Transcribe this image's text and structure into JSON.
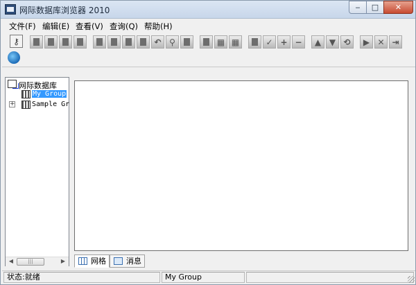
{
  "window": {
    "title": "网际数据库浏览器 2010",
    "controls": {
      "minimize": "‒",
      "maximize": "□",
      "close": "✕"
    }
  },
  "menu": [
    {
      "label": "文件(F)"
    },
    {
      "label": "编辑(E)"
    },
    {
      "label": "查看(V)"
    },
    {
      "label": "查询(Q)"
    },
    {
      "label": "帮助(H)"
    }
  ],
  "toolbar": {
    "row1_glyphs": [
      "✓",
      "+",
      "−",
      "▲",
      "▼",
      "▶",
      "✕"
    ]
  },
  "tree": {
    "root_label": "网际数据库",
    "items": [
      {
        "label": "My Group",
        "selected": true
      },
      {
        "label": "Sample Gr",
        "expander": "+"
      }
    ],
    "scroll_thumb": "|||"
  },
  "tabs": [
    {
      "label": "网格",
      "icon": "grid-icon",
      "active": true
    },
    {
      "label": "消息",
      "icon": "message-icon",
      "active": false
    }
  ],
  "status": {
    "left": "状态:就绪",
    "middle": "My Group",
    "right": ""
  },
  "colors": {
    "selection": "#3399ff",
    "close_button": "#c74b32",
    "titlebar": "#c7d6ea"
  }
}
